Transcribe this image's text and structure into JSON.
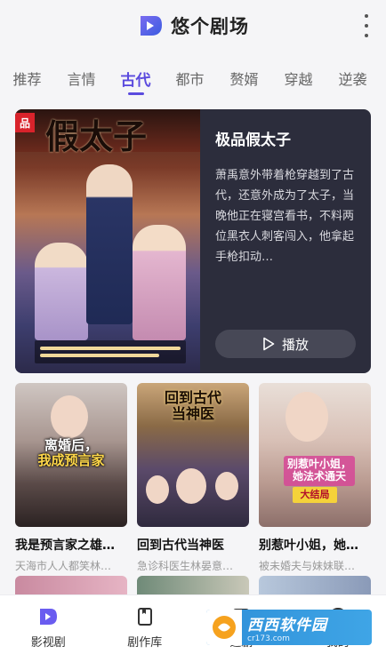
{
  "app": {
    "title": "悠个剧场",
    "brand_color": "#5b4bde"
  },
  "tabs": [
    {
      "label": "推荐",
      "active": false
    },
    {
      "label": "言情",
      "active": false
    },
    {
      "label": "古代",
      "active": true
    },
    {
      "label": "都市",
      "active": false
    },
    {
      "label": "赘婿",
      "active": false
    },
    {
      "label": "穿越",
      "active": false
    },
    {
      "label": "逆袭",
      "active": false
    }
  ],
  "featured": {
    "poster_title": "假太子",
    "poster_tag": "品",
    "title": "极品假太子",
    "description": "萧禹意外带着枪穿越到了古代，还意外成为了太子，当晚他正在寝宫看书，不料两位黑衣人刺客闯入，他拿起手枪扣动…",
    "play_label": "播放"
  },
  "dramas": [
    {
      "title": "我是预言家之雄…",
      "subtitle": "天海市人人都笑林…",
      "poster_text": "离婚后，",
      "poster_text_highlight": "我成预言家"
    },
    {
      "title": "回到古代当神医",
      "subtitle": "急诊科医生林晏意…",
      "poster_text": "回到古代当神医"
    },
    {
      "title": "别惹叶小姐，她…",
      "subtitle": "被未婚夫与妹妹联…",
      "poster_text": "别惹叶小姐，她法术通天",
      "poster_badge": "大结局"
    }
  ],
  "bottom_nav": [
    {
      "label": "影视剧",
      "icon": "drama-play-icon",
      "active": true
    },
    {
      "label": "剧作库",
      "icon": "library-icon",
      "active": false
    },
    {
      "label": "追剧",
      "icon": "bookmark-icon",
      "active": false
    },
    {
      "label": "我的",
      "icon": "profile-icon",
      "active": false
    }
  ],
  "watermark": {
    "main": "西西软件园",
    "sub": "cr173.com"
  }
}
